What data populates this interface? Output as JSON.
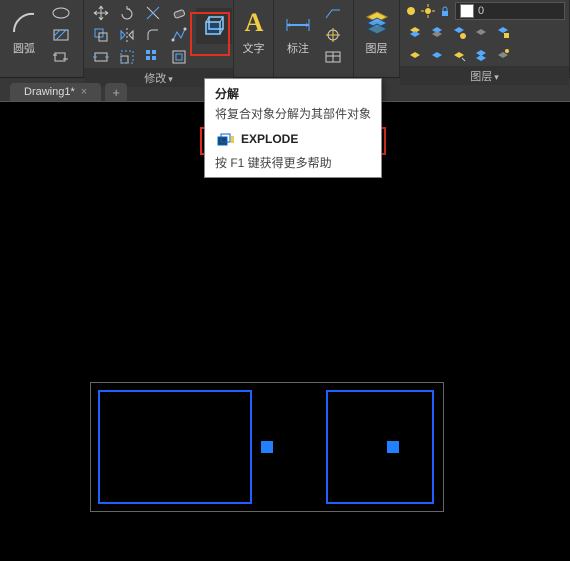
{
  "ribbon": {
    "panel_arc": {
      "title": "圆弧"
    },
    "panel_modify": {
      "title": "修改",
      "dropdown": "▾"
    },
    "panel_text": {
      "label": "文字"
    },
    "panel_annot": {
      "label": "标注"
    },
    "panel_layers": {
      "title": "图层",
      "dropdown": "▾"
    },
    "panel_layermgr": {
      "title": "图层",
      "dropdown": "▾"
    },
    "combo_value": "0"
  },
  "tab": {
    "name": "Drawing1*",
    "close": "×",
    "add": "+"
  },
  "tooltip": {
    "title": "分解",
    "desc": "将复合对象分解为其部件对象",
    "cmd": "EXPLODE",
    "help": "按 F1 键获得更多帮助"
  }
}
